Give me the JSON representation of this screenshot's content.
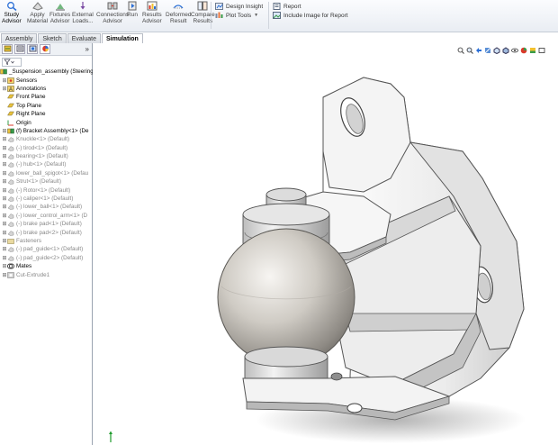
{
  "ribbon": {
    "buttons": [
      {
        "label": "Study\nAdvisor",
        "icon": "study-advisor-icon"
      },
      {
        "label": "Apply\nMaterial",
        "icon": "apply-material-icon"
      },
      {
        "label": "Fixtures\nAdvisor",
        "icon": "fixtures-icon"
      },
      {
        "label": "External\nLoads...",
        "icon": "loads-icon"
      },
      {
        "label": "Connections\nAdvisor",
        "icon": "connections-icon"
      },
      {
        "label": "Run",
        "icon": "run-icon"
      },
      {
        "label": "Results\nAdvisor",
        "icon": "results-icon"
      },
      {
        "label": "Deformed\nResult",
        "icon": "deformed-icon"
      },
      {
        "label": "Compare\nResults",
        "icon": "compare-icon"
      }
    ],
    "design_insight": "Design Insight",
    "plot_tools": "Plot Tools",
    "report": "Report",
    "include_image": "Include Image for Report"
  },
  "tabs": [
    "Assembly",
    "Sketch",
    "Evaluate",
    "Simulation"
  ],
  "active_tab": "Simulation",
  "panel": {
    "more": "»",
    "tree": [
      {
        "text": "_Suspension_assembly  (Steering",
        "level": 0,
        "icon": "assembly-icon",
        "pm": "",
        "style": "bold"
      },
      {
        "text": "Sensors",
        "level": 1,
        "icon": "sensor-icon",
        "pm": "+",
        "style": "bold"
      },
      {
        "text": "Annotations",
        "level": 1,
        "icon": "annotation-icon",
        "pm": "+",
        "style": "bold"
      },
      {
        "text": "Front Plane",
        "level": 1,
        "icon": "plane-icon",
        "pm": "",
        "style": "bold"
      },
      {
        "text": "Top Plane",
        "level": 1,
        "icon": "plane-icon",
        "pm": "",
        "style": "bold"
      },
      {
        "text": "Right Plane",
        "level": 1,
        "icon": "plane-icon",
        "pm": "",
        "style": "bold"
      },
      {
        "text": "Origin",
        "level": 1,
        "icon": "origin-icon",
        "pm": "",
        "style": "bold"
      },
      {
        "text": "(f) Bracket Assembly<1> (De",
        "level": 1,
        "icon": "assembly-icon",
        "pm": "+",
        "style": "bold"
      },
      {
        "text": "Knuckle<1> (Default)",
        "level": 1,
        "icon": "part-icon",
        "pm": "+",
        "style": "sup"
      },
      {
        "text": "(-) tirod<1> (Default)",
        "level": 1,
        "icon": "part-icon",
        "pm": "+",
        "style": "sup"
      },
      {
        "text": "bearing<1> (Default)",
        "level": 1,
        "icon": "part-icon",
        "pm": "+",
        "style": "sup"
      },
      {
        "text": "(-) hub<1> (Default)",
        "level": 1,
        "icon": "part-icon",
        "pm": "+",
        "style": "sup"
      },
      {
        "text": "lower_ball_spigot<1> (Defau",
        "level": 1,
        "icon": "part-icon",
        "pm": "+",
        "style": "sup"
      },
      {
        "text": "Strut<1> (Default)",
        "level": 1,
        "icon": "part-icon",
        "pm": "+",
        "style": "sup"
      },
      {
        "text": "(-) Rotor<1> (Default)",
        "level": 1,
        "icon": "part-icon",
        "pm": "+",
        "style": "sup"
      },
      {
        "text": "(-) caliper<1> (Default)",
        "level": 1,
        "icon": "part-icon",
        "pm": "+",
        "style": "sup"
      },
      {
        "text": "(-) lower_ball<1> (Default)",
        "level": 1,
        "icon": "part-icon",
        "pm": "+",
        "style": "sup"
      },
      {
        "text": "(-) lower_control_arm<1> (D",
        "level": 1,
        "icon": "part-icon",
        "pm": "+",
        "style": "sup"
      },
      {
        "text": "(-) brake pad<1> (Default)",
        "level": 1,
        "icon": "part-icon",
        "pm": "+",
        "style": "sup"
      },
      {
        "text": "(-) brake pad<2> (Default)",
        "level": 1,
        "icon": "part-icon",
        "pm": "+",
        "style": "sup"
      },
      {
        "text": "Fasteners",
        "level": 1,
        "icon": "folder-icon",
        "pm": "+",
        "style": "sup"
      },
      {
        "text": "(-) pad_guide<1> (Default)",
        "level": 1,
        "icon": "part-icon",
        "pm": "+",
        "style": "sup"
      },
      {
        "text": "(-) pad_guide<2> (Default)",
        "level": 1,
        "icon": "part-icon",
        "pm": "+",
        "style": "sup"
      },
      {
        "text": "Mates",
        "level": 1,
        "icon": "mates-icon",
        "pm": "+",
        "style": "bold"
      },
      {
        "text": "Cut-Extrude1",
        "level": 1,
        "icon": "cut-icon",
        "pm": "+",
        "style": "sup"
      }
    ]
  },
  "colors": {
    "accent": "#2b6fd6",
    "ribbon_bg": "#eef1f5",
    "suppressed_text": "#888888",
    "model_light": "#f4f4f4",
    "model_mid": "#d6d6d6",
    "model_dark": "#8c8c8c"
  },
  "heads_up_icons": [
    "zoom-to-fit-icon",
    "zoom-area-icon",
    "previous-view-icon",
    "section-view-icon",
    "view-orientation-icon",
    "display-style-icon",
    "hide-show-icon",
    "edit-appearance-icon",
    "scene-icon",
    "view-settings-icon"
  ]
}
